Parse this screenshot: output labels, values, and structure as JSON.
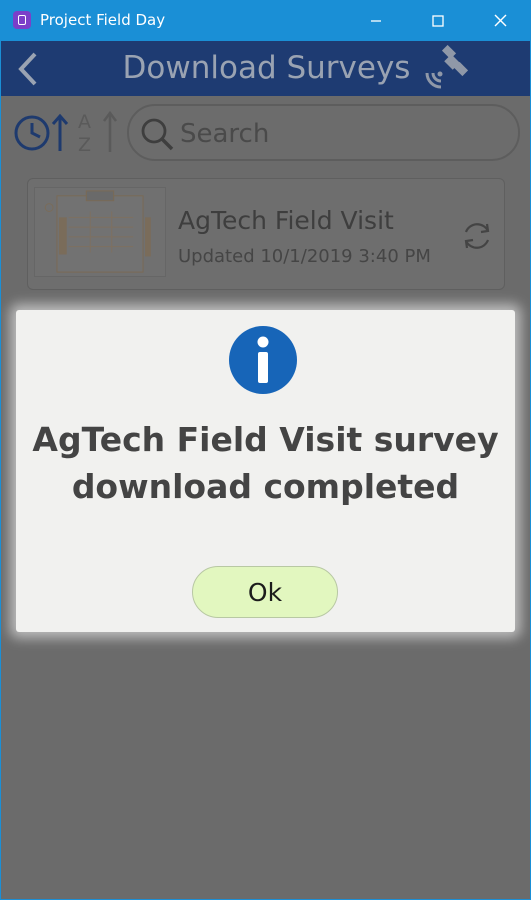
{
  "window": {
    "title": "Project Field Day",
    "icon": "app-logo-icon",
    "controls": [
      "minimize-icon",
      "maximize-icon",
      "close-icon"
    ]
  },
  "header": {
    "title": "Download Surveys",
    "left_icon": "back-chevron-icon",
    "right_icon": "satellite-gps-icon"
  },
  "toolbar": {
    "sort_icons": [
      "sort-by-time-icon",
      "sort-alphabetical-icon"
    ],
    "search": {
      "placeholder": "Search",
      "value": ""
    }
  },
  "surveys": [
    {
      "title": "AgTech Field Visit",
      "updated": "Updated 10/1/2019 3:40 PM",
      "thumbnail": "clipboard-illustration",
      "action_icon": "refresh-icon"
    }
  ],
  "dialog": {
    "icon": "info-icon",
    "message": "AgTech Field Visit survey download completed",
    "ok_label": "Ok"
  },
  "colors": {
    "titlebar": "#1a8fd6",
    "header": "#1e3b72",
    "overlay": "#6b6b6b",
    "dialog_bg": "#f1f1ef",
    "info_blue": "#1765b8",
    "ok_button": "#e2f7bf"
  }
}
